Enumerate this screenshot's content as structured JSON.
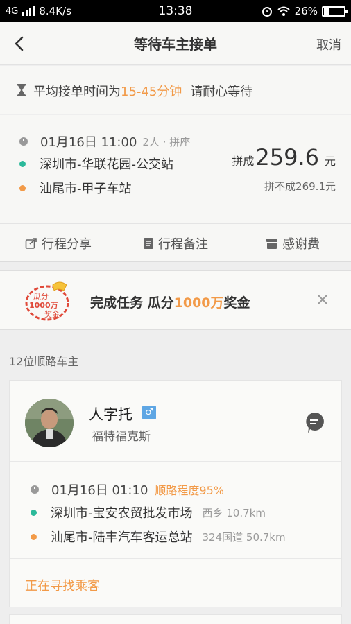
{
  "status_bar": {
    "network": "4G",
    "speed": "8.4K/s",
    "time": "13:38",
    "battery": "26%",
    "battery_level": 0.26
  },
  "header": {
    "title": "等待车主接单",
    "cancel_label": "取消"
  },
  "wait_notice": {
    "prefix": "平均接单时间为",
    "range": "15-45分钟",
    "suffix": "请耐心等待"
  },
  "trip": {
    "date_time": "01月16日 11:00",
    "seats": "2人 · 拼座",
    "origin": "深圳市-华联花园-公交站",
    "destination": "汕尾市-甲子车站",
    "price_label": "拼成",
    "price": "259.6",
    "price_unit": "元",
    "alt_price": "拼不成269.1元"
  },
  "actions": [
    {
      "label": "行程分享",
      "icon": "share-icon"
    },
    {
      "label": "行程备注",
      "icon": "note-icon"
    },
    {
      "label": "感谢费",
      "icon": "gift-icon"
    }
  ],
  "promo": {
    "badge_text_1": "瓜分",
    "badge_text_2": "1000万",
    "badge_text_3": "奖金",
    "text_prefix": "完成任务 瓜分",
    "text_highlight": "1000万",
    "text_suffix": "奖金"
  },
  "drivers_section": {
    "title": "12位顺路车主"
  },
  "driver_card": {
    "name": "人字托",
    "gender_symbol": "♂",
    "car": "福特福克斯",
    "date_time": "01月16日 01:10",
    "match": "顺路程度95%",
    "origin": "深圳市-宝安农贸批发市场",
    "origin_detail": "西乡 10.7km",
    "destination": "汕尾市-陆丰汽车客运总站",
    "destination_detail": "324国道 50.7km",
    "status": "正在寻找乘客"
  },
  "colors": {
    "accent_orange": "#f29a48",
    "teal": "#2bb99a",
    "gender_blue": "#5ea6e4"
  }
}
